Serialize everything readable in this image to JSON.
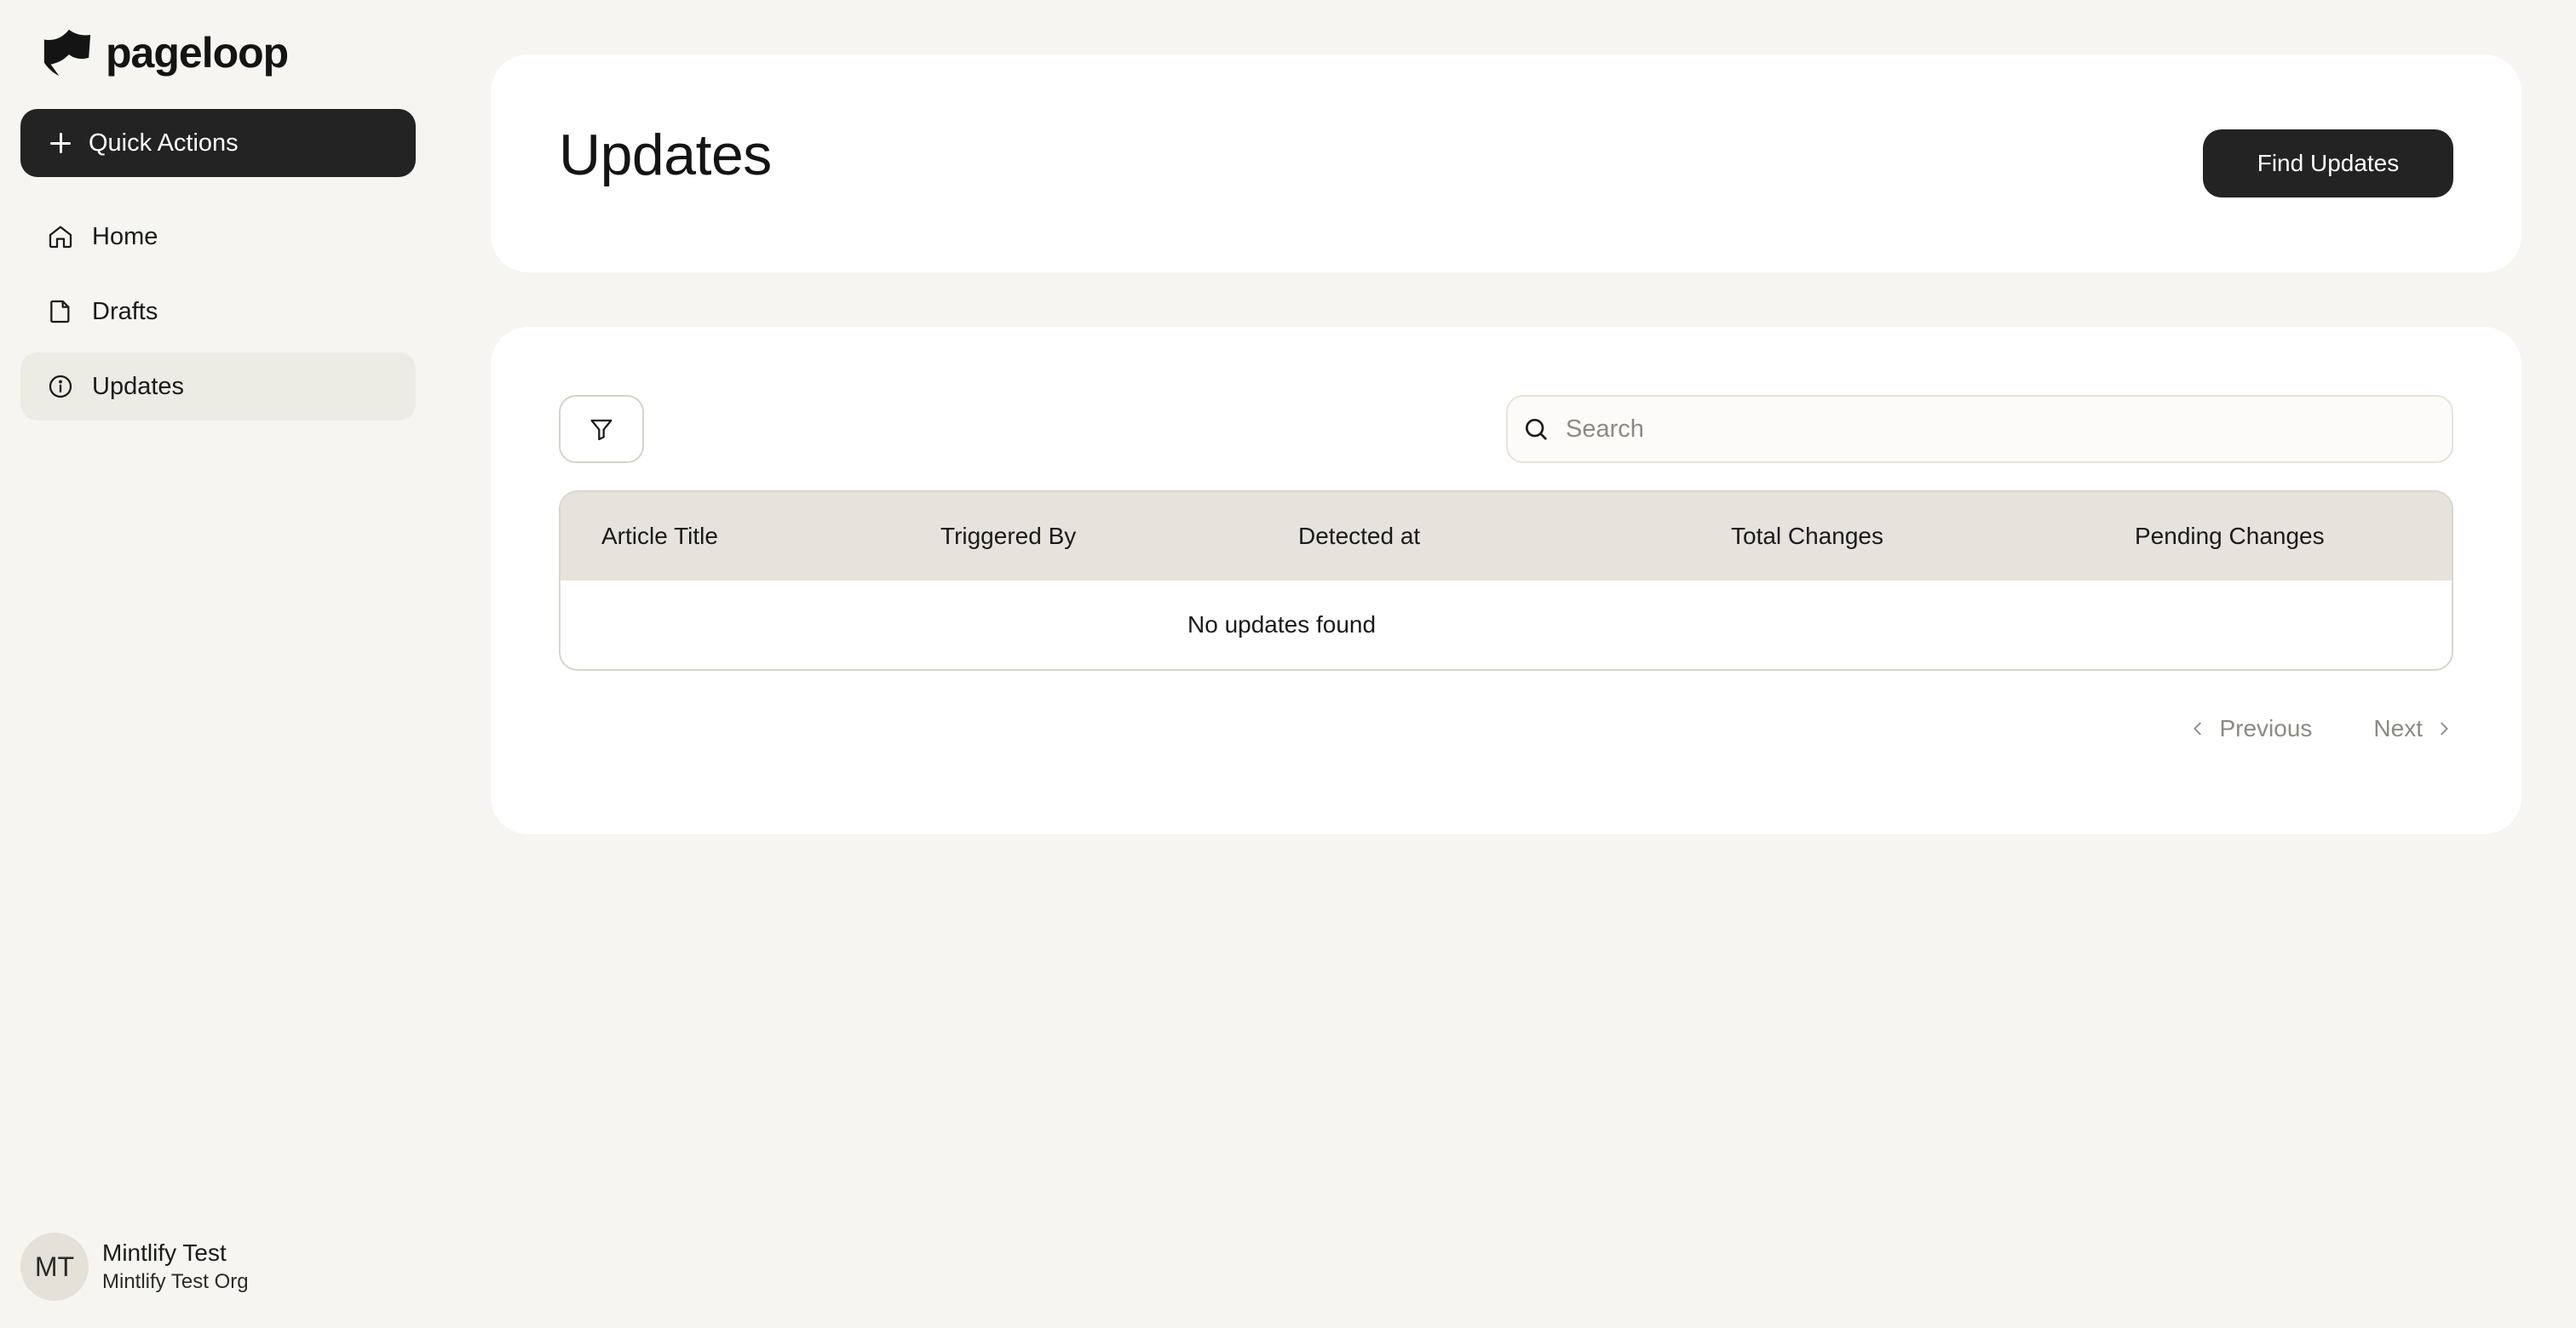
{
  "brand": {
    "name": "pageloop"
  },
  "sidebar": {
    "quick_actions_label": "Quick Actions",
    "items": [
      {
        "label": "Home",
        "icon": "home-icon"
      },
      {
        "label": "Drafts",
        "icon": "file-icon"
      },
      {
        "label": "Updates",
        "icon": "info-circle-icon",
        "active": true
      }
    ]
  },
  "user": {
    "initials": "MT",
    "name": "Mintlify Test",
    "org": "Mintlify Test Org"
  },
  "header": {
    "title": "Updates",
    "find_updates_label": "Find Updates"
  },
  "search": {
    "placeholder": "Search",
    "value": ""
  },
  "table": {
    "columns": [
      "Article Title",
      "Triggered By",
      "Detected at",
      "Total Changes",
      "Pending Changes"
    ],
    "rows": [],
    "empty_message": "No updates found"
  },
  "pagination": {
    "previous_label": "Previous",
    "next_label": "Next"
  },
  "colors": {
    "background": "#f6f5f1",
    "primary_button": "#232323",
    "active_nav": "#ecebe4",
    "table_header": "#e6e3dc",
    "muted_text": "#8d8a84"
  }
}
